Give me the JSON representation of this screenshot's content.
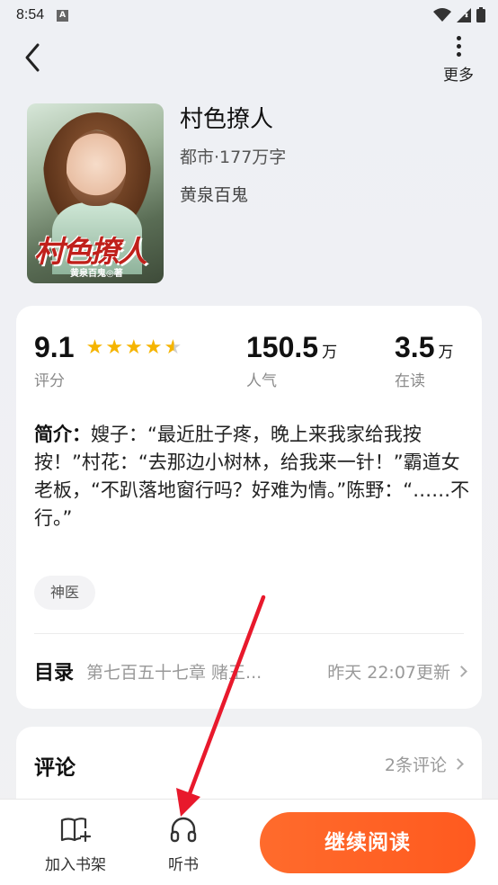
{
  "status_bar": {
    "time": "8:54",
    "notification_icon": "A"
  },
  "nav": {
    "more_label": "更多"
  },
  "book": {
    "title": "村色撩人",
    "meta": "都市·177万字",
    "author": "黄泉百鬼",
    "cover_title": "村色撩人",
    "cover_author": "黄泉百鬼◎著"
  },
  "stats": {
    "rating": {
      "value": "9.1",
      "label": "评分",
      "stars": 4.5
    },
    "popularity": {
      "value": "150.5",
      "unit": "万",
      "label": "人气"
    },
    "reading": {
      "value": "3.5",
      "unit": "万",
      "label": "在读"
    }
  },
  "intro": {
    "label": "简介：",
    "text": "嫂子：“最近肚子疼，晚上来我家给我按按！”村花：“去那边小树林，给我来一针！”霸道女老板，“不趴落地窗行吗？好难为情。”陈野：“……不行。”"
  },
  "tags": [
    "神医"
  ],
  "toc": {
    "label": "目录",
    "latest_chapter": "第七百五十七章 赌王...",
    "update_time": "昨天 22:07更新"
  },
  "comments": {
    "title": "评论",
    "count": "2条评论"
  },
  "bottom_bar": {
    "add_shelf_label": "加入书架",
    "listen_label": "听书",
    "continue_label": "继续阅读"
  },
  "colors": {
    "accent": "#ff5f22",
    "star": "#f5b400",
    "annotation_arrow": "#e8192c"
  }
}
